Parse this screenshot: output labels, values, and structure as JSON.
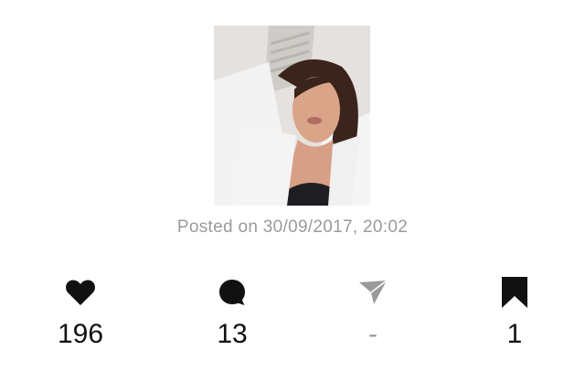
{
  "post": {
    "posted_text": "Posted on 30/09/2017, 20:02"
  },
  "stats": {
    "likes": {
      "icon": "heart-icon",
      "count": "196"
    },
    "comments": {
      "icon": "comment-bubble-icon",
      "count": "13"
    },
    "shares": {
      "icon": "send-arrow-icon",
      "count": "-"
    },
    "saves": {
      "icon": "bookmark-icon",
      "count": "1"
    }
  },
  "colors": {
    "icon_dark": "#111111",
    "icon_muted": "#9a9a9a",
    "text_muted": "#9a9a9a"
  }
}
